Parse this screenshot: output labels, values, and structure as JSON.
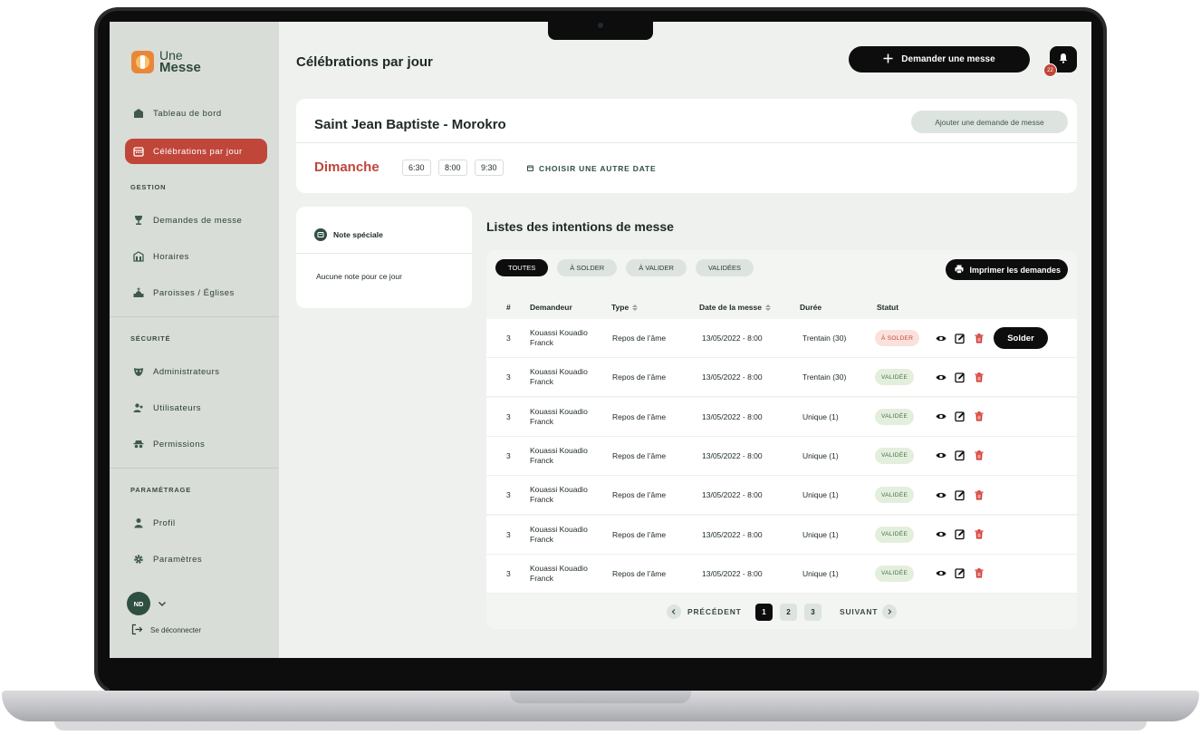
{
  "app": {
    "logo_line1": "Une",
    "logo_line2": "Messe"
  },
  "sidebar": {
    "top_items": [
      {
        "label": "Tableau de bord",
        "icon": "home-icon"
      },
      {
        "label": "Célébrations par jour",
        "icon": "calendar-icon",
        "active": true
      }
    ],
    "sections": [
      {
        "title": "GESTION",
        "items": [
          "Demandes de messe",
          "Horaires",
          "Paroisses / Églises"
        ]
      },
      {
        "title": "SÉCURITÉ",
        "items": [
          "Administrateurs",
          "Utilisateurs",
          "Permissions"
        ]
      },
      {
        "title": "PARAMÉTRAGE",
        "items": [
          "Profil",
          "Paramètres"
        ]
      }
    ],
    "user_initials": "ND",
    "logout_label": "Se déconnecter"
  },
  "header": {
    "title": "Célébrations par jour",
    "request_button": "Demander une messe",
    "notifications_count": "22"
  },
  "church": {
    "name": "Saint Jean Baptiste - Morokro",
    "add_request_button": "Ajouter une demande de messe",
    "day": "Dimanche",
    "times": [
      "6:30",
      "8:00",
      "9:30"
    ],
    "choose_date": "CHOISIR UNE AUTRE DATE"
  },
  "note": {
    "title": "Note spéciale",
    "text": "Aucune note pour ce jour"
  },
  "intentions": {
    "title": "Listes des intentions de messe",
    "tabs": [
      "TOUTES",
      "À SOLDER",
      "À VALIDER",
      "VALIDÉES"
    ],
    "print_button": "Imprimer les demandes",
    "columns": [
      "#",
      "Demandeur",
      "Type",
      "Date de la messe",
      "Durée",
      "Statut"
    ],
    "rows": [
      {
        "num": "3",
        "demandeur": "Kouassi Kouadio Franck",
        "type": "Repos de l’âme",
        "date": "13/05/2022 - 8:00",
        "duree": "Trentain (30)",
        "statut": "À SOLDER",
        "action": "Solder"
      },
      {
        "num": "3",
        "demandeur": "Kouassi Kouadio Franck",
        "type": "Repos de l’âme",
        "date": "13/05/2022 - 8:00",
        "duree": "Trentain (30)",
        "statut": "VALIDÉE"
      },
      {
        "num": "3",
        "demandeur": "Kouassi Kouadio Franck",
        "type": "Repos de l’âme",
        "date": "13/05/2022 - 8:00",
        "duree": "Unique (1)",
        "statut": "VALIDÉE"
      },
      {
        "num": "3",
        "demandeur": "Kouassi Kouadio Franck",
        "type": "Repos de l’âme",
        "date": "13/05/2022 - 8:00",
        "duree": "Unique (1)",
        "statut": "VALIDÉE"
      },
      {
        "num": "3",
        "demandeur": "Kouassi Kouadio Franck",
        "type": "Repos de l’âme",
        "date": "13/05/2022 - 8:00",
        "duree": "Unique (1)",
        "statut": "VALIDÉE"
      },
      {
        "num": "3",
        "demandeur": "Kouassi Kouadio Franck",
        "type": "Repos de l’âme",
        "date": "13/05/2022 - 8:00",
        "duree": "Unique (1)",
        "statut": "VALIDÉE"
      },
      {
        "num": "3",
        "demandeur": "Kouassi Kouadio Franck",
        "type": "Repos de l’âme",
        "date": "13/05/2022 - 8:00",
        "duree": "Unique (1)",
        "statut": "VALIDÉE"
      }
    ],
    "pagination": {
      "prev": "PRÉCÉDENT",
      "next": "SUIVANT",
      "pages": [
        "1",
        "2",
        "3"
      ],
      "current": "1"
    }
  },
  "colors": {
    "accent": "#c0463a",
    "dark": "#0d0d0e",
    "sidebar_bg": "#d8ddd8",
    "validated": "#48704a"
  }
}
